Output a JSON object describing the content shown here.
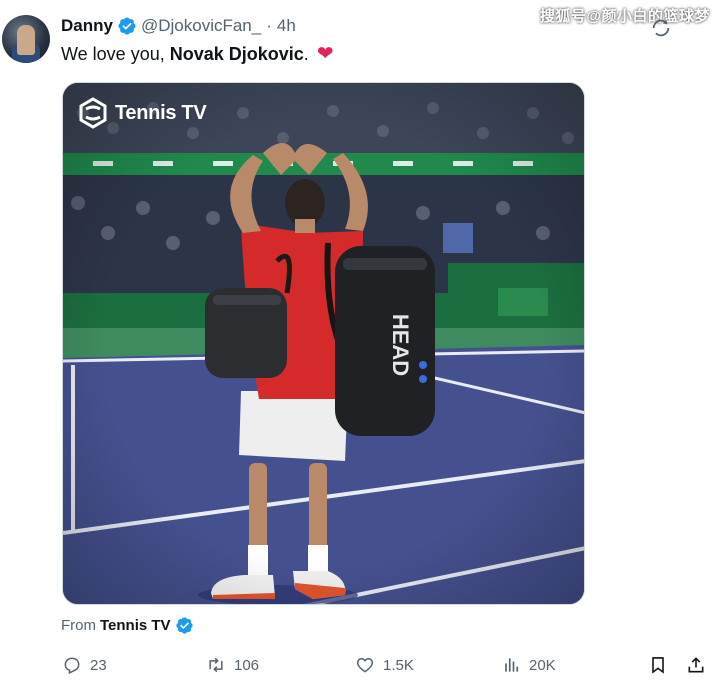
{
  "watermark": "搜狐号@颜小白的篮球梦",
  "tweet": {
    "author_name": "Danny",
    "handle": "@DjokovicFan_",
    "separator": "·",
    "time": "4h",
    "text_prefix": "We love you, ",
    "text_bold": "Novak Djokovic",
    "text_suffix": ".",
    "emoji": "❤"
  },
  "media": {
    "logo_text": "Tennis TV",
    "bag_text": "HEAD"
  },
  "source": {
    "prefix": "From",
    "name": "Tennis TV"
  },
  "actions": {
    "replies": "23",
    "reposts": "106",
    "likes": "1.5K",
    "views": "20K"
  },
  "colors": {
    "accent": "#1d9bf0",
    "heart": "#e0245e",
    "muted": "#536471",
    "court": "#45518f",
    "shirt": "#d42a2a"
  }
}
